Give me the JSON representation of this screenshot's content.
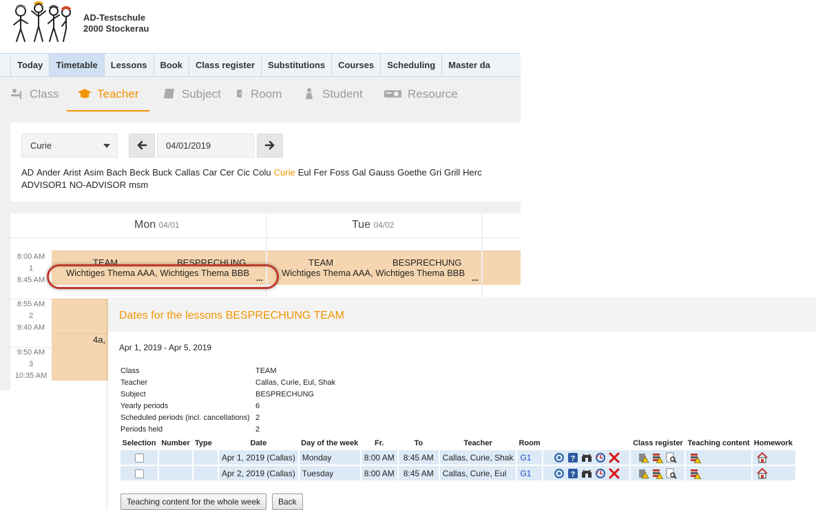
{
  "school": {
    "name": "AD-Testschule",
    "location": "2000 Stockerau"
  },
  "main_nav": [
    "Today",
    "Timetable",
    "Lessons",
    "Book",
    "Class register",
    "Substitutions",
    "Courses",
    "Scheduling",
    "Master da"
  ],
  "main_nav_active": "Timetable",
  "sub_nav": {
    "class": "Class",
    "teacher": "Teacher",
    "subject": "Subject",
    "room": "Room",
    "student": "Student",
    "resource": "Resource",
    "active": "Teacher"
  },
  "filter": {
    "selected_teacher": "Curie",
    "date": "04/01/2019",
    "prev_icon": "arrow-left-icon",
    "next_icon": "arrow-right-icon"
  },
  "teachers_row1": [
    "AD",
    "Ander",
    "Arist",
    "Asim",
    "Bach",
    "Beck",
    "Buck",
    "Callas",
    "Car",
    "Cer",
    "Cic",
    "Colu",
    "Curie",
    "Eul",
    "Fer",
    "Foss",
    "Gal",
    "Gauss",
    "Goethe",
    "Gri",
    "Grill",
    "Herc"
  ],
  "teachers_row2": [
    "ADVISOR1",
    "NO-ADVISOR",
    "msm"
  ],
  "timetable": {
    "days": [
      {
        "name": "Mon",
        "date": "04/01"
      },
      {
        "name": "Tue",
        "date": "04/02"
      }
    ],
    "periods": [
      {
        "start": "8:00 AM",
        "num": "1",
        "end": "8:45 AM"
      },
      {
        "start": "8:55 AM",
        "num": "2",
        "end": "9:40 AM"
      },
      {
        "start": "9:50 AM",
        "num": "3",
        "end": "10:35 AM"
      }
    ],
    "lesson": {
      "class": "TEAM",
      "subject": "BESPRECHUNG",
      "notes": "Wichtiges Thema AAA, Wichtiges Thema BBB",
      "more": "..."
    },
    "other_lesson_class": "4a,"
  },
  "dialog": {
    "title": "Dates for the lessons BESPRECHUNG TEAM",
    "date_range": "Apr 1, 2019 - Apr 5, 2019",
    "info": [
      {
        "label": "Class",
        "value": "TEAM"
      },
      {
        "label": "Teacher",
        "value": "Callas, Curie, Eul, Shak"
      },
      {
        "label": "Subject",
        "value": "BESPRECHUNG"
      },
      {
        "label": "Yearly periods",
        "value": "6"
      },
      {
        "label": "Scheduled periods (incl. cancellations)",
        "value": "2"
      },
      {
        "label": "Periods held",
        "value": "2"
      }
    ],
    "columns": {
      "selection": "Selection",
      "number": "Number",
      "type": "Type",
      "date": "Date",
      "weekday": "Day of the week",
      "from": "Fr.",
      "to": "To",
      "teacher": "Teacher",
      "room": "Room",
      "class_register": "Class register",
      "teaching_content": "Teaching content",
      "homework": "Homework"
    },
    "rows": [
      {
        "number": "",
        "type": "",
        "date": "Apr 1, 2019 (Callas)",
        "weekday": "Monday",
        "from": "8:00 AM",
        "to": "8:45 AM",
        "teacher": "Callas, Curie, Shak",
        "room": "G1"
      },
      {
        "number": "",
        "type": "",
        "date": "Apr 2, 2019 (Callas)",
        "weekday": "Tuesday",
        "from": "8:00 AM",
        "to": "8:45 AM",
        "teacher": "Callas, Curie, Eul",
        "room": "G1"
      }
    ],
    "buttons": {
      "whole_week": "Teaching content for the whole week",
      "back": "Back"
    }
  },
  "colors": {
    "accent": "#f29400",
    "lesson_bg": "#f5d6b0",
    "nav_active": "#cfe0f2",
    "highlight": "#c0392b",
    "link": "#1a4fc1"
  }
}
